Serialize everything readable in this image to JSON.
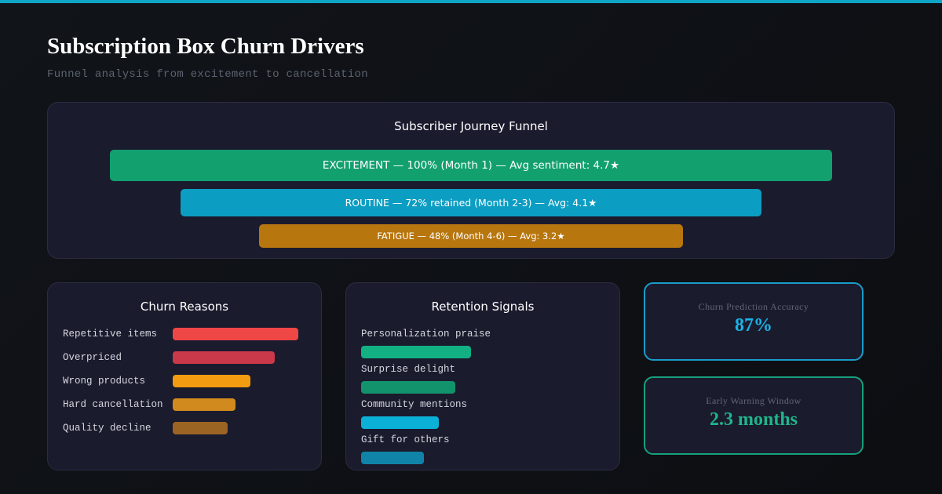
{
  "header": {
    "title": "Subscription Box Churn Drivers",
    "subtitle": "Funnel analysis from excitement to cancellation"
  },
  "funnel": {
    "title": "Subscriber Journey Funnel",
    "stages": [
      {
        "label": "EXCITEMENT — 100% (Month 1) — Avg sentiment: 4.7★",
        "value": 100,
        "color": "#12a06f"
      },
      {
        "label": "ROUTINE — 72% retained (Month 2-3) — Avg: 4.1★",
        "value": 72,
        "color": "#0c9dc2"
      },
      {
        "label": "FATIGUE — 48% (Month 4-6) — Avg: 3.2★",
        "value": 48,
        "color": "#b8760f"
      }
    ]
  },
  "churn_reasons": {
    "title": "Churn Reasons",
    "items": [
      {
        "label": "Repetitive items",
        "value": 100,
        "color": "#ef4646"
      },
      {
        "label": "Overpriced",
        "value": 81,
        "color": "#c9394a"
      },
      {
        "label": "Wrong products",
        "value": 62,
        "color": "#f39c12"
      },
      {
        "label": "Hard cancellation",
        "value": 50,
        "color": "#d08a1e"
      },
      {
        "label": "Quality decline",
        "value": 44,
        "color": "#9c6423"
      }
    ]
  },
  "retention_signals": {
    "title": "Retention Signals",
    "items": [
      {
        "label": "Personalization praise",
        "value": 100,
        "color": "#13b083"
      },
      {
        "label": "Surprise delight",
        "value": 86,
        "color": "#12936c"
      },
      {
        "label": "Community mentions",
        "value": 71,
        "color": "#0bb0d6"
      },
      {
        "label": "Gift for others",
        "value": 57,
        "color": "#0f84a8"
      }
    ]
  },
  "stats": [
    {
      "label": "Churn Prediction Accuracy",
      "value": "87%",
      "color": "#1ab3e6",
      "border": "#1a9cc8"
    },
    {
      "label": "Early Warning Window",
      "value": "2.3 months",
      "color": "#1fb58a",
      "border": "#16a07b"
    }
  ],
  "chart_data": [
    {
      "type": "bar",
      "title": "Subscriber Journey Funnel",
      "categories": [
        "EXCITEMENT",
        "ROUTINE",
        "FATIGUE"
      ],
      "values": [
        100,
        72,
        48
      ]
    },
    {
      "type": "bar",
      "title": "Churn Reasons",
      "categories": [
        "Repetitive items",
        "Overpriced",
        "Wrong products",
        "Hard cancellation",
        "Quality decline"
      ],
      "values": [
        100,
        81,
        62,
        50,
        44
      ]
    },
    {
      "type": "bar",
      "title": "Retention Signals",
      "categories": [
        "Personalization praise",
        "Surprise delight",
        "Community mentions",
        "Gift for others"
      ],
      "values": [
        100,
        86,
        71,
        57
      ]
    }
  ]
}
